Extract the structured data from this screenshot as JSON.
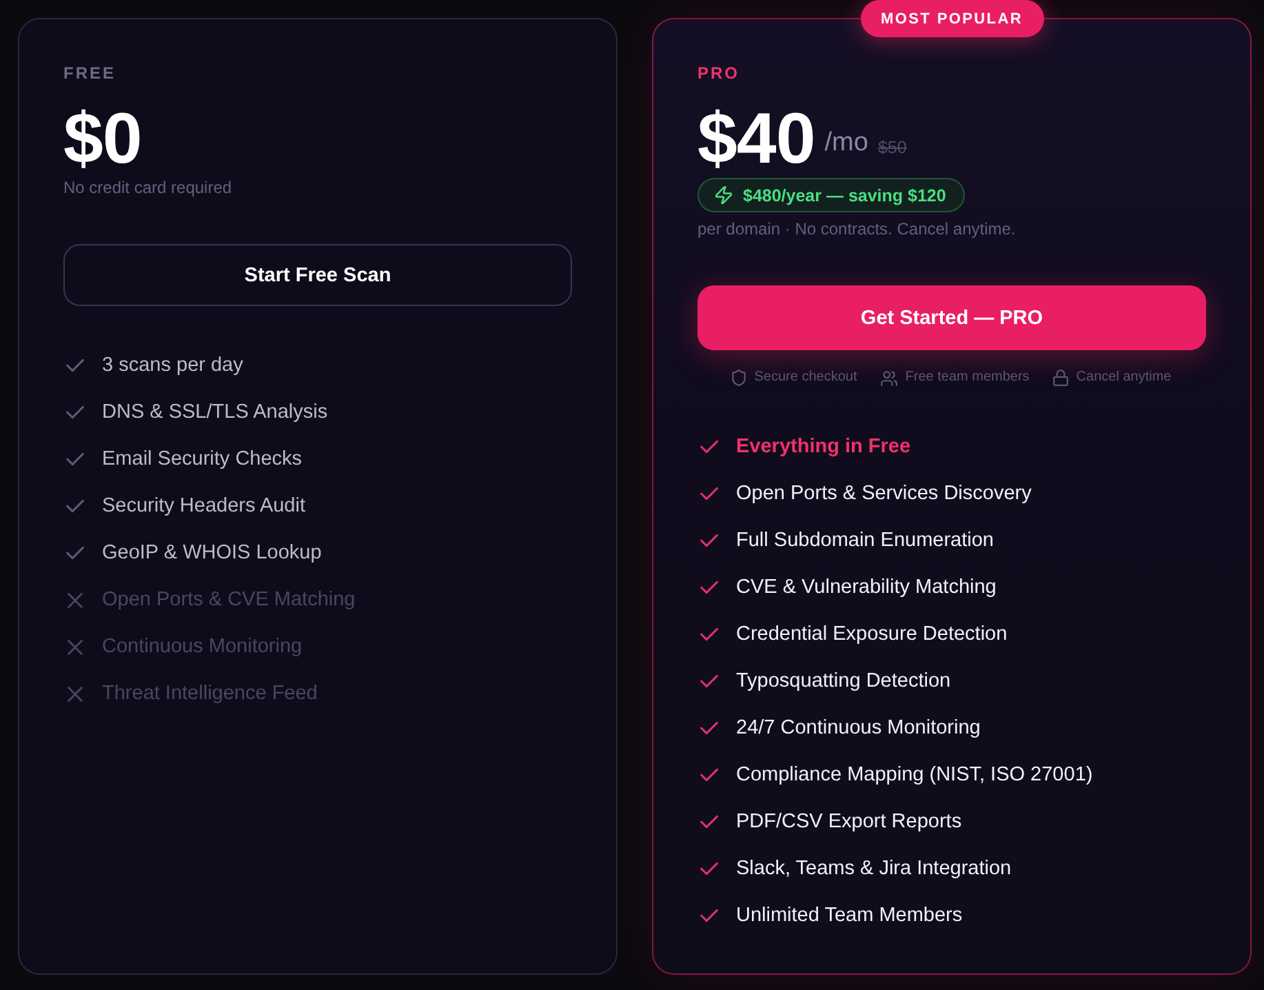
{
  "plans": [
    {
      "kind": "free",
      "name": "FREE",
      "price": "$0",
      "note": "No credit card required",
      "cta": "Start Free Scan",
      "features": [
        {
          "text": "3 scans per day",
          "included": true,
          "highlighted": false
        },
        {
          "text": "DNS & SSL/TLS Analysis",
          "included": true,
          "highlighted": false
        },
        {
          "text": "Email Security Checks",
          "included": true,
          "highlighted": false
        },
        {
          "text": "Security Headers Audit",
          "included": true,
          "highlighted": false
        },
        {
          "text": "GeoIP & WHOIS Lookup",
          "included": true,
          "highlighted": false
        },
        {
          "text": "Open Ports & CVE Matching",
          "included": false,
          "highlighted": false
        },
        {
          "text": "Continuous Monitoring",
          "included": false,
          "highlighted": false
        },
        {
          "text": "Threat Intelligence Feed",
          "included": false,
          "highlighted": false
        }
      ]
    },
    {
      "kind": "pro",
      "badge": "MOST POPULAR",
      "name": "PRO",
      "price": "$40",
      "period": "/mo",
      "old_price": "$50",
      "savings": "$480/year — saving $120",
      "note": "per domain · No contracts. Cancel anytime.",
      "cta": "Get Started — PRO",
      "trust": [
        "Secure checkout",
        "Free team members",
        "Cancel anytime"
      ],
      "features": [
        {
          "text": "Everything in Free",
          "included": true,
          "highlighted": true
        },
        {
          "text": "Open Ports & Services Discovery",
          "included": true,
          "highlighted": false
        },
        {
          "text": "Full Subdomain Enumeration",
          "included": true,
          "highlighted": false
        },
        {
          "text": "CVE & Vulnerability Matching",
          "included": true,
          "highlighted": false
        },
        {
          "text": "Credential Exposure Detection",
          "included": true,
          "highlighted": false
        },
        {
          "text": "Typosquatting Detection",
          "included": true,
          "highlighted": false
        },
        {
          "text": "24/7 Continuous Monitoring",
          "included": true,
          "highlighted": false
        },
        {
          "text": "Compliance Mapping (NIST, ISO 27001)",
          "included": true,
          "highlighted": false
        },
        {
          "text": "PDF/CSV Export Reports",
          "included": true,
          "highlighted": false
        },
        {
          "text": "Slack, Teams & Jira Integration",
          "included": true,
          "highlighted": false
        },
        {
          "text": "Unlimited Team Members",
          "included": true,
          "highlighted": false
        }
      ]
    }
  ]
}
